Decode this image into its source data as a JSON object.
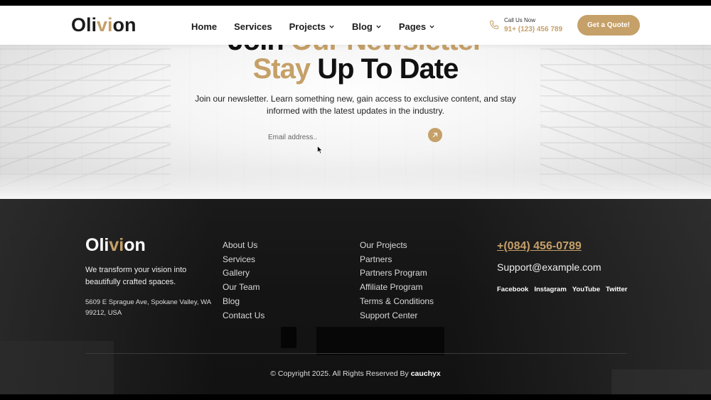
{
  "header": {
    "logo": {
      "part1": "Oli",
      "part2": "vi",
      "part3": "on"
    },
    "nav": [
      {
        "label": "Home",
        "has_dropdown": false
      },
      {
        "label": "Services",
        "has_dropdown": false
      },
      {
        "label": "Projects",
        "has_dropdown": true
      },
      {
        "label": "Blog",
        "has_dropdown": true
      },
      {
        "label": "Pages",
        "has_dropdown": true
      }
    ],
    "call": {
      "label": "Call Us Now",
      "phone": "91+ (123) 456 789",
      "icon": "phone-icon"
    },
    "quote_button": "Get a Quote!"
  },
  "newsletter": {
    "title_top": {
      "part1": "Join ",
      "accent": "Our Newsletter"
    },
    "title": {
      "accent": "Stay",
      "rest": " Up To Date"
    },
    "description": "Join our newsletter. Learn something new, gain access to exclusive content, and stay informed with the latest updates in the industry.",
    "email_placeholder": "Email address..",
    "submit_icon": "arrow-up-right-icon"
  },
  "footer": {
    "logo": {
      "part1": "Oli",
      "part2": "vi",
      "part3": "on"
    },
    "tagline": "We transform your vision into beautifully crafted spaces.",
    "address": "5609 E Sprague Ave, Spokane Valley, WA 99212, USA",
    "links_col1": [
      "About Us",
      "Services",
      "Gallery",
      "Our Team",
      "Blog",
      "Contact Us"
    ],
    "links_col2": [
      "Our Projects",
      "Partners",
      "Partners Program",
      "Affiliate Program",
      "Terms & Conditions",
      "Support Center"
    ],
    "phone": "+(084) 456-0789",
    "email": "Support@example.com",
    "social": [
      "Facebook",
      "Instagram",
      "YouTube",
      "Twitter"
    ],
    "copyright": "© Copyright 2025. All Rights Reserved By ",
    "copyright_brand": "cauchyx"
  },
  "colors": {
    "accent": "#c5a068",
    "dark": "#1b1b1b",
    "footer_bg": "#151515"
  }
}
